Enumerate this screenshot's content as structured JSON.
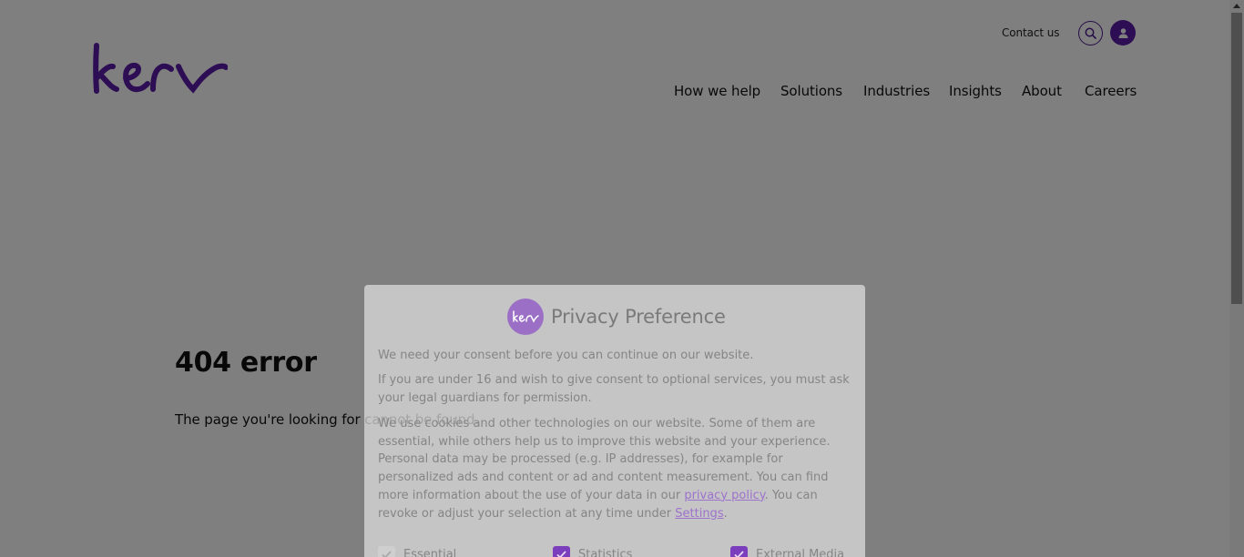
{
  "header": {
    "contact_label": "Contact us",
    "nav": [
      "How we help",
      "Solutions",
      "Industries",
      "Insights",
      "About",
      "Careers"
    ]
  },
  "main": {
    "error_title": "404 error",
    "error_message": "The page you're looking for cannot be found."
  },
  "modal": {
    "title": "Privacy Preference",
    "p1": "We need your consent before you can continue on our website.",
    "p2": "If you are under 16 and wish to give consent to optional services, you must ask your legal guardians for permission.",
    "p3_before_link": "We use cookies and other technologies on our website. Some of them are essential, while others help us to improve this website and your experience. Personal data may be processed (e.g. IP addresses), for example for personalized ads and content or ad and content measurement. You can find more information about the use of your data in our ",
    "privacy_link": "privacy policy",
    "p3_middle": ". You can revoke or adjust your selection at any time under ",
    "settings_link": "Settings",
    "p3_end": ".",
    "checkboxes": [
      {
        "label": "Essential",
        "checked": true,
        "disabled": true
      },
      {
        "label": "Statistics",
        "checked": true,
        "disabled": false
      },
      {
        "label": "External Media",
        "checked": true,
        "disabled": false
      }
    ]
  },
  "colors": {
    "brand": "#5b1aa8",
    "checkbox_on": "#7b3fbd"
  },
  "icons": [
    "kerv-logo",
    "search-icon",
    "user-icon",
    "check-icon"
  ]
}
